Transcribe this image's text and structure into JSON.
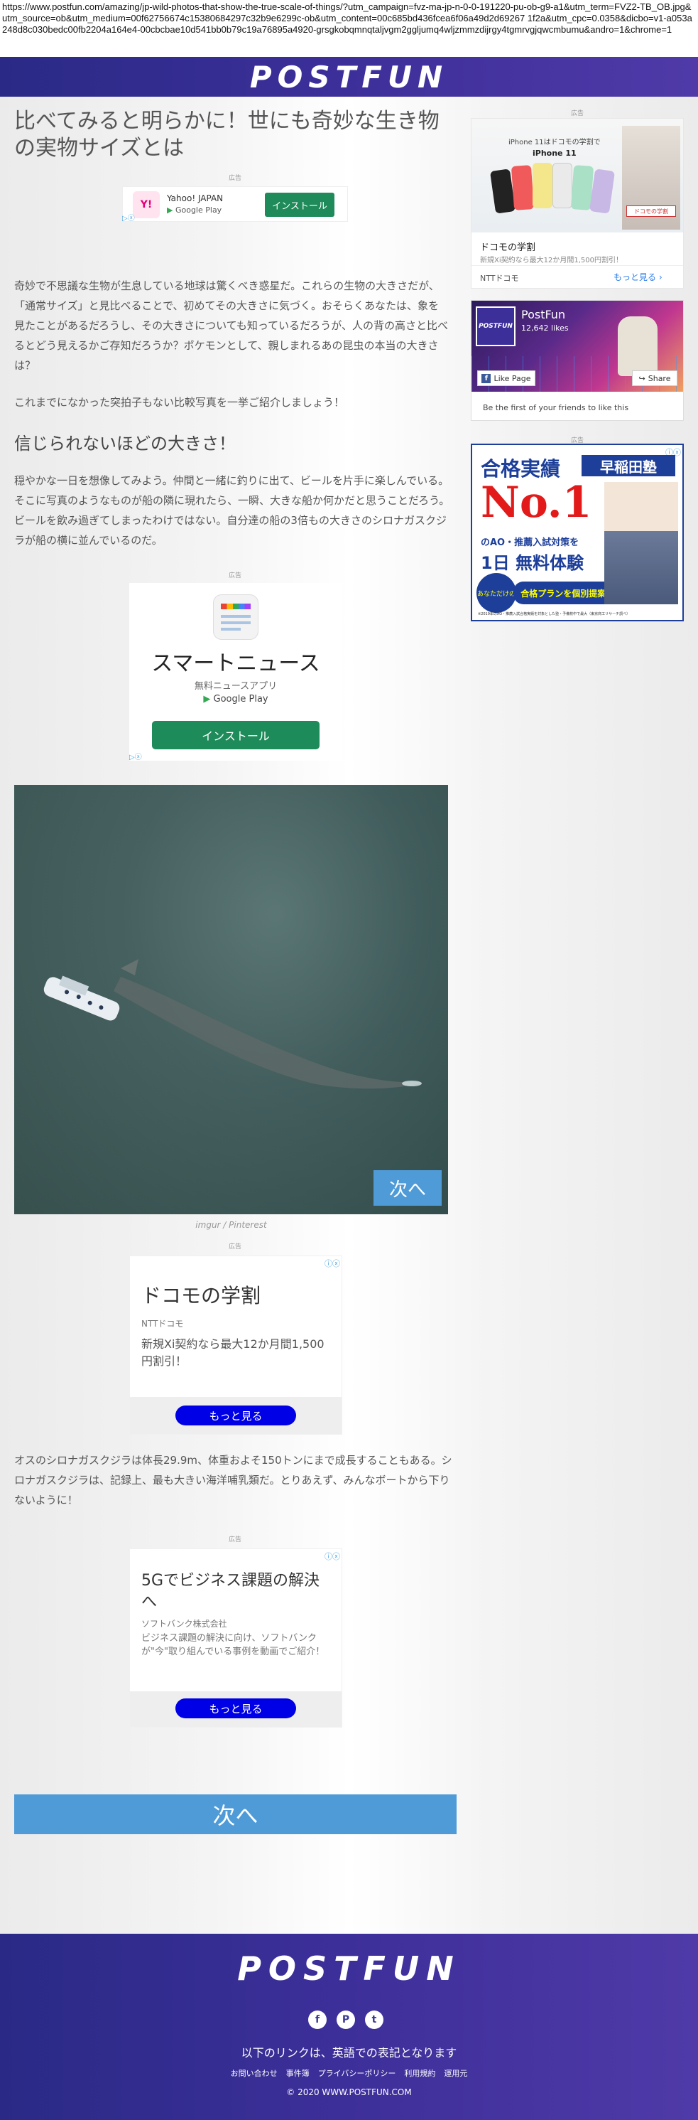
{
  "url": "https://www.postfun.com/amazing/jp-wild-photos-that-show-the-true-scale-of-things/?utm_campaign=fvz-ma-jp-n-0-0-191220-pu-ob-g9-a1&utm_term=FVZ2-TB_OB.jpg&utm_source=ob&utm_medium=00f62756674c15380684297c32b9e6299c-ob&utm_content=00c685bd436fcea6f06a49d2d69267 1f2a&utm_cpc=0.0358&dicbo=v1-a053a248d8c030bedc00fb2204a164e4-00cbcbae10d541bb0b79c19a76895a4920-grsgkobqmnqtaljvgm2ggljumq4wljzmmzdijrgy4tgmrvgjqwcmbumu&andro=1&chrome=1",
  "header": {
    "logo": "POSTFUN"
  },
  "article": {
    "title": "比べてみると明らかに！世にも奇妙な生き物の実物サイズとは",
    "ad_label": "広告",
    "p1": "奇妙で不思議な生物が生息している地球は驚くべき惑星だ。これらの生物の大きさだが、「通常サイズ」と見比べることで、初めてその大きさに気づく。おそらくあなたは、象を見たことがあるだろうし、その大きさについても知っているだろうが、人の背の高さと比べるとどう見えるかご存知だろうか？ポケモンとして、親しまれるあの昆虫の本当の大きさは？",
    "p2": "これまでになかった突拍子もない比較写真を一挙ご紹介しましょう！",
    "h2": "信じられないほどの大きさ！",
    "p3": "穏やかな一日を想像してみよう。仲間と一緒に釣りに出て、ビールを片手に楽しんでいる。そこに写真のようなものが船の隣に現れたら、一瞬、大きな船か何かだと思うことだろう。ビールを飲み過ぎてしまったわけではない。自分達の船の3倍もの大きさのシロナガスクジラが船の横に並んでいるのだ。",
    "image_credit": "imgur / Pinterest",
    "next_label": "次へ",
    "p4": "オスのシロナガスクジラは体長29.9m、体重およそ150トンにまで成長することもある。シロナガスクジラは、記録上、最も大きい海洋哺乳類だ。とりあえず、みんなボートから下りないように！"
  },
  "ads": {
    "yahoo": {
      "name": "Yahoo! JAPAN",
      "store": "Google Play",
      "button": "インストール"
    },
    "smart": {
      "title": "スマートニュース",
      "subtitle": "無料ニュースアプリ",
      "store": "Google Play",
      "button": "インストール"
    },
    "docomo": {
      "title": "ドコモの学割",
      "brand": "NTTドコモ",
      "desc": "新規Xi契約なら最大12か月間1,500円割引！",
      "button": "もっと見る"
    },
    "softbank": {
      "title": "5Gでビジネス課題の解決へ",
      "brand": "ソフトバンク株式会社",
      "desc": "ビジネス課題の解決に向け、ソフトバンクが\"今\"取り組んでいる事例を動画でご紹介！",
      "button": "もっと見る"
    }
  },
  "sidebar": {
    "ad_label": "広告",
    "docomo": {
      "top": "iPhone 11はドコモの学割で",
      "phone": "iPhone 11",
      "title": "ドコモの学割",
      "desc": "新規Xi契約なら最大12か月間1,500円割引！",
      "brand": "NTTドコモ",
      "more": "もっと見る",
      "stamp": "ドコモの学割"
    },
    "fb": {
      "name": "PostFun",
      "likes": "12,642 likes",
      "like_btn": "Like Page",
      "share_btn": "Share",
      "note": "Be the first of your friends to like this"
    },
    "waseda": {
      "heading": "合格実績",
      "brand": "早稲田塾",
      "no1": "No.1",
      "line1": "のAO・推薦入試対策を",
      "line2": "1日 無料体験",
      "badge": "あなただけの",
      "line3": "合格プランを個別提案!",
      "foot": "※2019年のAO・推薦入試合格実績を対象とした塾・予備校中で最大（東京商工リサーチ調べ）"
    }
  },
  "footer": {
    "logo": "POSTFUN",
    "note": "以下のリンクは、英語での表記となります",
    "links": [
      "お問い合わせ",
      "事件簿",
      "プライバシーポリシー",
      "利用規約",
      "運用元"
    ],
    "copyright": "© 2020 WWW.POSTFUN.COM"
  }
}
